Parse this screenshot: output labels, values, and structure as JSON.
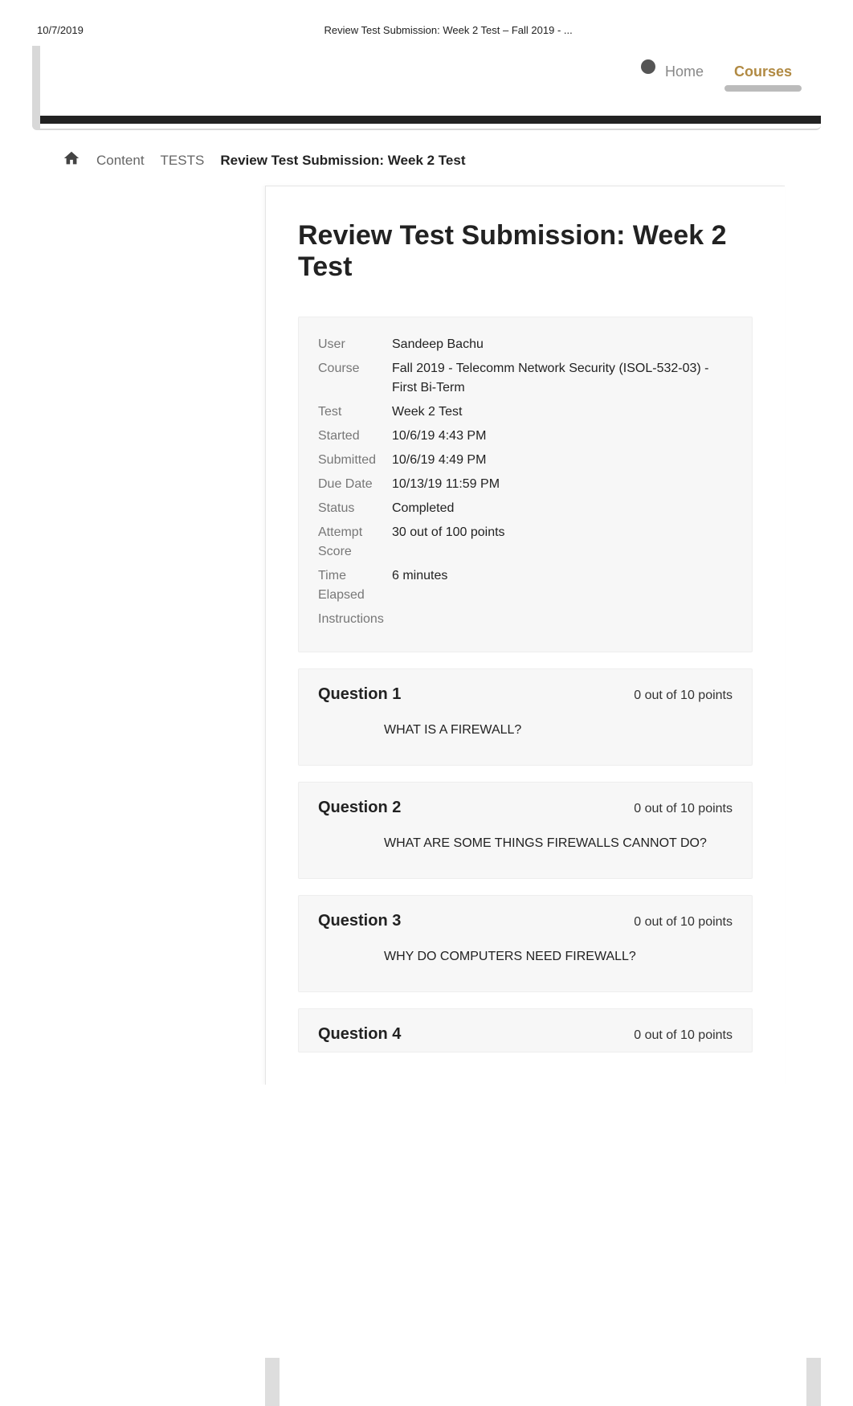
{
  "print_header": {
    "date": "10/7/2019",
    "title": "Review Test Submission: Week 2 Test – Fall 2019 - ..."
  },
  "nav": {
    "home": "Home",
    "courses": "Courses"
  },
  "breadcrumb": {
    "content": "Content",
    "tests": "TESTS",
    "current": "Review Test Submission: Week 2 Test"
  },
  "page_title": "Review Test Submission: Week 2 Test",
  "info": {
    "user_label": "User",
    "user_value": "Sandeep Bachu",
    "course_label": "Course",
    "course_value": "Fall 2019 - Telecomm Network Security (ISOL-532-03) - First Bi-Term",
    "test_label": "Test",
    "test_value": "Week 2 Test",
    "started_label": "Started",
    "started_value": "10/6/19 4:43 PM",
    "submitted_label": "Submitted",
    "submitted_value": "10/6/19 4:49 PM",
    "due_label": "Due Date",
    "due_value": "10/13/19 11:59 PM",
    "status_label": "Status",
    "status_value": "Completed",
    "score_label": "Attempt Score",
    "score_value": "30 out of 100 points",
    "time_label": "Time Elapsed",
    "time_value": "6 minutes",
    "instructions_label": "Instructions",
    "instructions_value": ""
  },
  "questions": [
    {
      "title": "Question 1",
      "points": "0 out of 10 points",
      "text": "WHAT IS A FIREWALL?"
    },
    {
      "title": "Question 2",
      "points": "0 out of 10 points",
      "text": "WHAT ARE SOME THINGS FIREWALLS CANNOT DO?"
    },
    {
      "title": "Question 3",
      "points": "0 out of 10 points",
      "text": "WHY DO COMPUTERS NEED FIREWALL?"
    },
    {
      "title": "Question 4",
      "points": "0 out of 10 points",
      "text": ""
    }
  ]
}
